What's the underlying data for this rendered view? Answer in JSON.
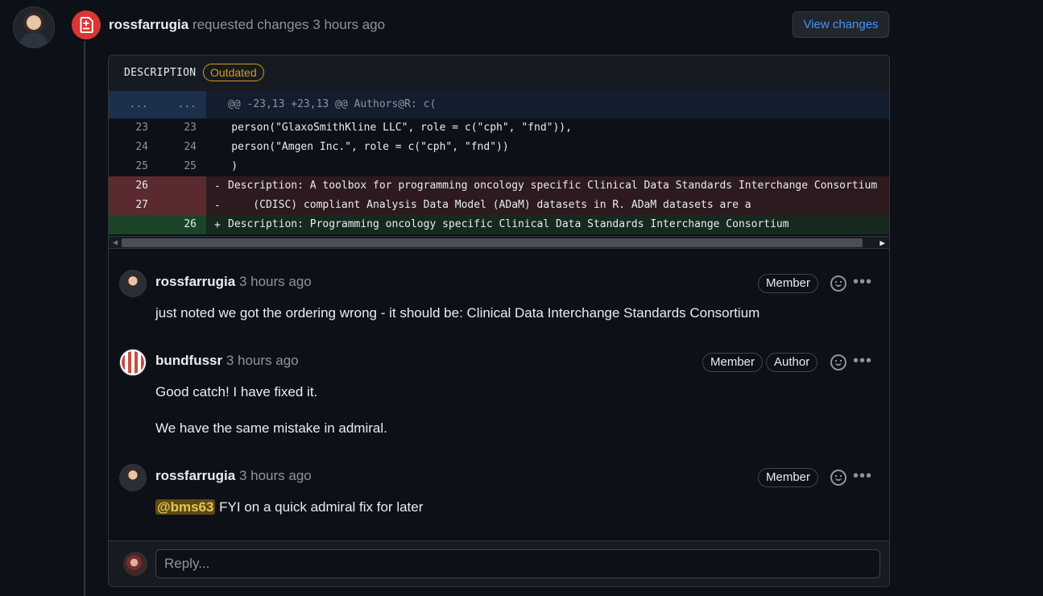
{
  "review": {
    "author": "rossfarrugia",
    "action": "requested changes",
    "time": "3 hours ago",
    "view_changes_label": "View changes"
  },
  "file": {
    "name": "DESCRIPTION",
    "status_badge": "Outdated"
  },
  "diff": {
    "hunk": {
      "old": "...",
      "new": "...",
      "text": "@@ -23,13 +23,13 @@ Authors@R: c("
    },
    "lines": [
      {
        "type": "context",
        "old": "23",
        "new": "23",
        "sign": "",
        "text": "    person(\"GlaxoSmithKline LLC\", role = c(\"cph\", \"fnd\")),"
      },
      {
        "type": "context",
        "old": "24",
        "new": "24",
        "sign": "",
        "text": "    person(\"Amgen Inc.\", role = c(\"cph\", \"fnd\"))"
      },
      {
        "type": "context",
        "old": "25",
        "new": "25",
        "sign": "",
        "text": "    )"
      },
      {
        "type": "del",
        "old": "26",
        "new": "",
        "sign": "-",
        "text": "Description: A toolbox for programming oncology specific Clinical Data Standards Interchange Consortium"
      },
      {
        "type": "del",
        "old": "27",
        "new": "",
        "sign": "-",
        "text": "    (CDISC) compliant Analysis Data Model (ADaM) datasets in R. ADaM datasets are a"
      },
      {
        "type": "add",
        "old": "",
        "new": "26",
        "sign": "+",
        "text": "Description: Programming oncology specific Clinical Data Standards Interchange Consortium"
      }
    ]
  },
  "comments": [
    {
      "author": "rossfarrugia",
      "time": "3 hours ago",
      "badges": [
        "Member"
      ],
      "body": [
        "just noted we got the ordering wrong - it should be: Clinical Data Interchange Standards Consortium"
      ]
    },
    {
      "author": "bundfussr",
      "time": "3 hours ago",
      "badges": [
        "Member",
        "Author"
      ],
      "body": [
        "Good catch! I have fixed it.",
        "We have the same mistake in admiral."
      ]
    },
    {
      "author": "rossfarrugia",
      "time": "3 hours ago",
      "badges": [
        "Member"
      ],
      "mention": "@bms63",
      "body": [
        " FYI on a quick admiral fix for later"
      ]
    }
  ],
  "reply": {
    "placeholder": "Reply..."
  },
  "icons": {
    "review": "file-diff-icon",
    "emoji": "smiley-icon",
    "more": "kebab-horizontal-icon"
  },
  "colors": {
    "accent": "#4493f8",
    "danger": "#da3633",
    "warning": "#d29922"
  }
}
